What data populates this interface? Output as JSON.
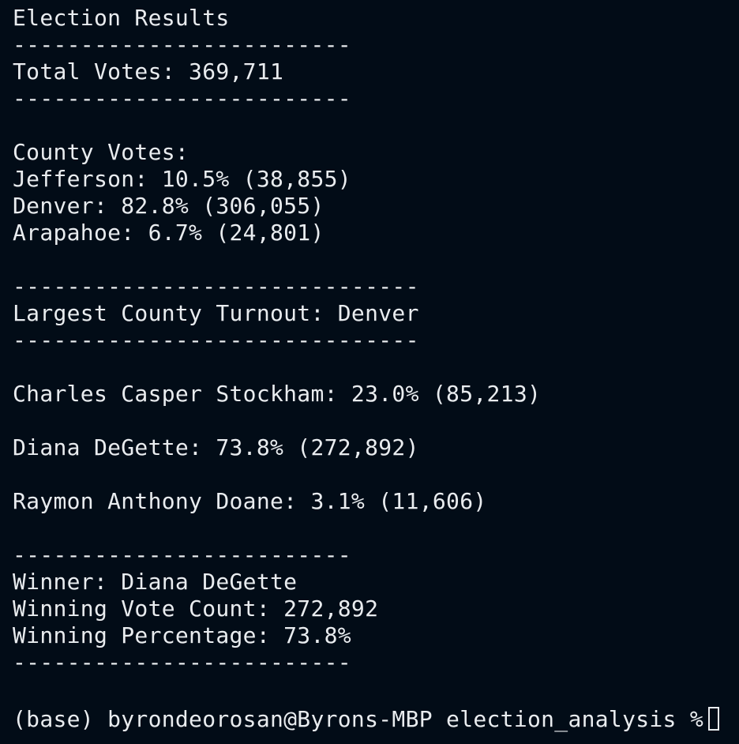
{
  "terminal": {
    "lines": [
      "Election Results",
      "-------------------------",
      "Total Votes: 369,711",
      "-------------------------",
      "",
      "County Votes:",
      "Jefferson: 10.5% (38,855)",
      "Denver: 82.8% (306,055)",
      "Arapahoe: 6.7% (24,801)",
      "",
      "------------------------------",
      "Largest County Turnout: Denver",
      "------------------------------",
      "",
      "Charles Casper Stockham: 23.0% (85,213)",
      "",
      "Diana DeGette: 73.8% (272,892)",
      "",
      "Raymon Anthony Doane: 3.1% (11,606)",
      "",
      "-------------------------",
      "Winner: Diana DeGette",
      "Winning Vote Count: 272,892",
      "Winning Percentage: 73.8%",
      "-------------------------"
    ],
    "prompt": "(base) byrondeorosan@Byrons-MBP election_analysis %"
  },
  "colors": {
    "background": "#020c17",
    "text": "#e9ecef"
  }
}
